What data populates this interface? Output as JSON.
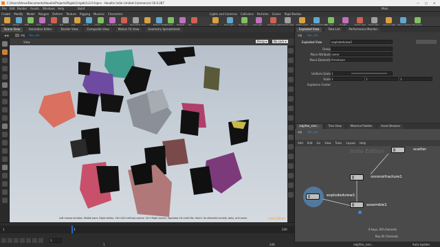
{
  "window": {
    "title": "C:/Users/Steve/Documents/HoudiniProjects/Rigids1/rigids1v2.0.hipnc - Houdini Indie Limited-Commercial 16.0.287",
    "controls": [
      "—",
      "□",
      "✕"
    ]
  },
  "menu": [
    "File",
    "Edit",
    "Render",
    "Assets",
    "Windows",
    "Help",
    "Build"
  ],
  "desktop": "Main",
  "shelf_tabs": [
    "Create",
    "Modify",
    "Model",
    "Polygon",
    "Deform",
    "Texture",
    "Rigging",
    "Muscles",
    "Characters"
  ],
  "shelf_tabs_right": [
    "Lights and Cameras",
    "Collisions",
    "Particles",
    "Grains",
    "Rigid Bodies"
  ],
  "shelf_tools_left": [
    "Box",
    "Sphere",
    "Tube",
    "Torus",
    "Grid",
    "Null",
    "Line",
    "Circle",
    "Curve",
    "Draw Curve",
    "Path",
    "Spray Paint",
    "Font",
    "Platonic Solids",
    "L-System",
    "Metaball",
    "File"
  ],
  "shelf_tools_right": [
    "Camera",
    "Point Light",
    "Spot Light",
    "Area Light",
    "Geometry Light",
    "Volume Light",
    "Distant Light",
    "Environment Light",
    "Sky Light",
    "GI Light",
    "Caustic Light",
    "Portal Light",
    "Ambient Light",
    "Stereo Camera",
    "VR Camera"
  ],
  "pane_tabs": [
    "Scene View",
    "Animation Editor",
    "Render View",
    "Composite View",
    "Motion FX View",
    "Geometry Spreadsheet"
  ],
  "right_pane_tabs": [
    "Exploded View",
    "Take List",
    "Performance Monitor"
  ],
  "path": {
    "obj": "obj",
    "node": "the_sim"
  },
  "viewport": {
    "label": "View",
    "persp": "Persp ▾",
    "cam": "No cam ▾",
    "status": "Left mouse tumbles. Middle pans. Right dollies. Ctrl+Alt+Left box-zooms. Ctrl+Right zooms. Spacebar-Ctrl-Left tilts. Hold L for alternate tumble, dolly, and zoom.",
    "corner": "Indie Edition"
  },
  "params": {
    "node_type": "Exploded View",
    "node_name": "explodedview1",
    "rows": [
      {
        "label": "Group",
        "value": ""
      },
      {
        "label": "Piece Attribute",
        "value": "name"
      },
      {
        "label": "Piece Elements",
        "value": "Primitives"
      },
      {
        "label": "Uniform Scale",
        "value": "1"
      },
      {
        "label": "Scale",
        "value": "1"
      },
      {
        "label": "Explosion Center",
        "value": ""
      }
    ],
    "scale_vec": [
      "1",
      "1",
      "1"
    ]
  },
  "network": {
    "tabs": [
      "/obj/the_sim/...",
      "Tree View",
      "Material Palette",
      "Asset Browser"
    ],
    "menu": [
      "Add",
      "Edit",
      "Go",
      "View",
      "Tools",
      "Layout",
      "Help"
    ],
    "path": {
      "obj": "obj",
      "node": "the_sim"
    },
    "watermark": "Indie Edition",
    "nodes": {
      "scatter": "scatter",
      "voronoi": "voronoifracture1",
      "exploded": "explodedview1",
      "assemble": "assemble1"
    }
  },
  "timeline": {
    "start": "1",
    "end": "240",
    "current": "1",
    "frame_field": "1",
    "range_start": "1",
    "range_end": "240",
    "keys_label": "0 keys, 0/0 channels",
    "key_all": "Key All Channels"
  },
  "status": {
    "path": "/obj/the_sim/...",
    "auto_update": "Auto Update"
  },
  "colors": {
    "accent": "#f0a030",
    "node_blue": "#5aa0e0",
    "viewport_bg": "#c0c8d2"
  }
}
